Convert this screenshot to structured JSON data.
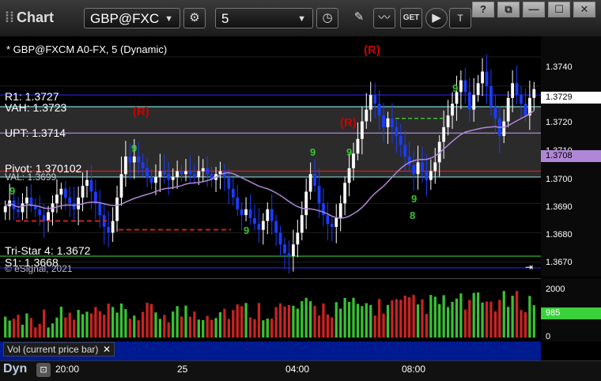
{
  "toolbar": {
    "title": "Chart",
    "symbol": "GBP@FXC",
    "interval": "5",
    "get_label": "GET",
    "window_buttons": [
      "?",
      "⧉",
      "—",
      "☐",
      "✕"
    ]
  },
  "chart": {
    "header": "* GBP@FXCM A0-FX, 5 (Dynamic)",
    "watermark": "© eSignal, 2021",
    "levels": [
      {
        "label": "R1: 1.3727",
        "price": 1.3727,
        "color": "#2222cc"
      },
      {
        "label": "VAH: 1.3723",
        "price": 1.3723,
        "color": "#7fd4d4"
      },
      {
        "label": "UPT: 1.3714",
        "price": 1.3714,
        "color": "#b087d6"
      },
      {
        "label": "Pivot: 1.370102",
        "price": 1.3701,
        "color": "#cc2222"
      },
      {
        "label": "VAL: 1.3699",
        "price": 1.3699,
        "color": "#7fd4d4"
      },
      {
        "label": "Tri-Star 4: 1.3672",
        "price": 1.3672,
        "color": "#39c233"
      },
      {
        "label": "S1: 1.3668",
        "price": 1.3668,
        "color": "#2222cc"
      }
    ],
    "price_ticks": [
      "1.3740",
      "1.3730",
      "1.3720",
      "1.3710",
      "1.3700",
      "1.3690",
      "1.3680",
      "1.3670"
    ],
    "last_price": "1.3729",
    "ma_price": "1.3708",
    "time_ticks": [
      "20:00",
      "25",
      "04:00",
      "08:00"
    ],
    "signals": [
      "9",
      "9",
      "9",
      "9",
      "9",
      "9",
      "8",
      "9"
    ],
    "r_marks": [
      "(R)",
      "(R)",
      "(R)"
    ]
  },
  "volume": {
    "legend": "Vol (current price bar)",
    "close_label": "✕",
    "ticks": [
      "2000",
      "1000",
      "0"
    ],
    "current": "985"
  },
  "footer": {
    "label": "Dyn"
  },
  "chart_data": {
    "type": "line",
    "title": "* GBP@FXCM A0-FX, 5 (Dynamic)",
    "xlabel": "",
    "ylabel": "",
    "ylim": [
      1.3665,
      1.3747
    ],
    "x": [
      "20:00",
      "25",
      "04:00",
      "08:00"
    ],
    "series": [
      {
        "values": [
          1.3689,
          1.3691,
          1.3688,
          1.3687,
          1.369,
          1.3692,
          1.3689,
          1.3688,
          1.3686,
          1.3684,
          1.3687,
          1.369,
          1.3693,
          1.3695,
          1.3692,
          1.369,
          1.3688,
          1.3692,
          1.3696,
          1.3698,
          1.3694,
          1.369,
          1.3686,
          1.3682,
          1.368,
          1.3684,
          1.3692,
          1.37,
          1.3706,
          1.3704,
          1.3706,
          1.3704,
          1.3702,
          1.3699,
          1.3697,
          1.3699,
          1.3701,
          1.37,
          1.3698,
          1.3699,
          1.3701,
          1.37,
          1.3701,
          1.37,
          1.3699,
          1.3701,
          1.3702,
          1.37,
          1.3698,
          1.37,
          1.3701,
          1.3699,
          1.3695,
          1.3692,
          1.3688,
          1.3686,
          1.3688,
          1.3685,
          1.3683,
          1.3681,
          1.3684,
          1.3688,
          1.3684,
          1.368,
          1.3676,
          1.3673,
          1.3672,
          1.3676,
          1.368,
          1.3686,
          1.3694,
          1.37,
          1.3696,
          1.369,
          1.3686,
          1.3683,
          1.3682,
          1.3685,
          1.369,
          1.3697,
          1.3702,
          1.3707,
          1.3712,
          1.3718,
          1.3722,
          1.3727,
          1.3724,
          1.372,
          1.3716,
          1.3719,
          1.3716,
          1.3713,
          1.371,
          1.3706,
          1.3703,
          1.37,
          1.3704,
          1.3701,
          1.3698,
          1.3701,
          1.3704,
          1.3711,
          1.3716,
          1.372,
          1.3724,
          1.3728,
          1.3732,
          1.3728,
          1.3722,
          1.3727,
          1.3731,
          1.3735,
          1.373,
          1.3723,
          1.3719,
          1.3713,
          1.3718,
          1.3726,
          1.3731,
          1.3727,
          1.3724,
          1.372,
          1.3726,
          1.3729
        ]
      }
    ]
  }
}
